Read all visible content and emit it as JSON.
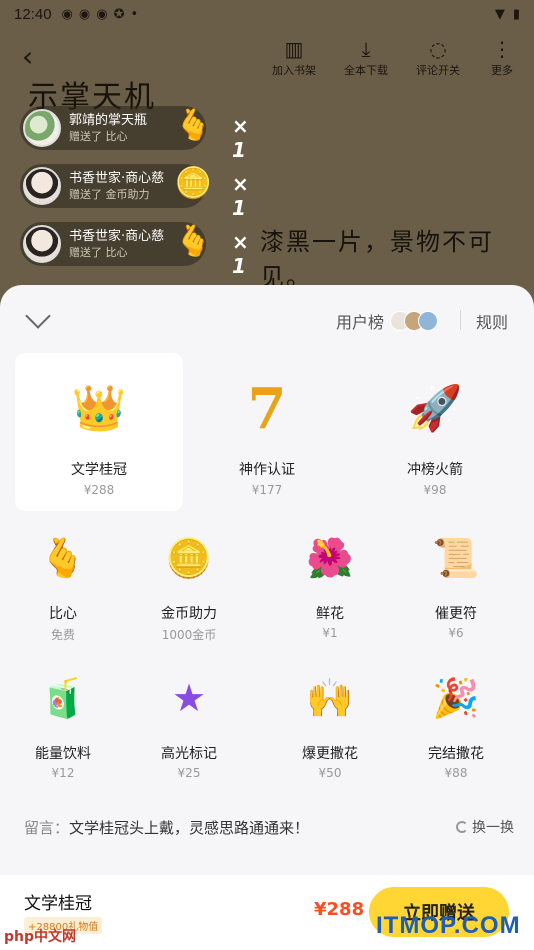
{
  "status_bar": {
    "time": "12:40",
    "icons": [
      "weibo-icon",
      "weibo-icon",
      "weibo-icon",
      "app-icon",
      "•"
    ]
  },
  "toolbar": {
    "add_shelf": "加入书架",
    "download_all": "全本下载",
    "comment_toggle": "评论开关",
    "more": "更多"
  },
  "background_text": {
    "title": "示掌天机",
    "line": "漆黑一片，景物不可见。"
  },
  "gift_toasts": [
    {
      "user": "郭靖的掌天瓶",
      "action": "赠送了 比心",
      "count": "× 1",
      "gift_icon": "heart-hand"
    },
    {
      "user": "书香世家·商心慈",
      "action": "赠送了 金币助力",
      "count": "× 1",
      "gift_icon": "coins"
    },
    {
      "user": "书香世家·商心慈",
      "action": "赠送了 比心",
      "count": "× 1",
      "gift_icon": "heart-hand"
    }
  ],
  "sheet": {
    "rank_label": "用户榜",
    "rules_label": "规则",
    "gifts": [
      {
        "name": "文学桂冠",
        "price": "¥288",
        "icon": "crown",
        "selected": true
      },
      {
        "name": "神作认证",
        "price": "¥177",
        "icon": "trophy-7"
      },
      {
        "name": "冲榜火箭",
        "price": "¥98",
        "icon": "rocket"
      },
      {
        "name": "比心",
        "price": "免费",
        "icon": "heart-hand"
      },
      {
        "name": "金币助力",
        "price": "1000金币",
        "icon": "coins"
      },
      {
        "name": "鲜花",
        "price": "¥1",
        "icon": "flower"
      },
      {
        "name": "催更符",
        "price": "¥6",
        "icon": "scroll"
      },
      {
        "name": "能量饮料",
        "price": "¥12",
        "icon": "drink"
      },
      {
        "name": "高光标记",
        "price": "¥25",
        "icon": "star"
      },
      {
        "name": "爆更撒花",
        "price": "¥50",
        "icon": "confetti-hands"
      },
      {
        "name": "完结撒花",
        "price": "¥88",
        "icon": "party-popper"
      }
    ],
    "message_label": "留言：",
    "message_text": "文学桂冠头上戴，灵感思路通通来！",
    "refresh_label": "换一换"
  },
  "footer": {
    "selected_name": "文学桂冠",
    "badge": "+28800礼物值",
    "total_price": "¥288",
    "send_label": "立即赠送"
  },
  "watermarks": {
    "left": "php中文网",
    "right": "ITMOP.COM"
  }
}
